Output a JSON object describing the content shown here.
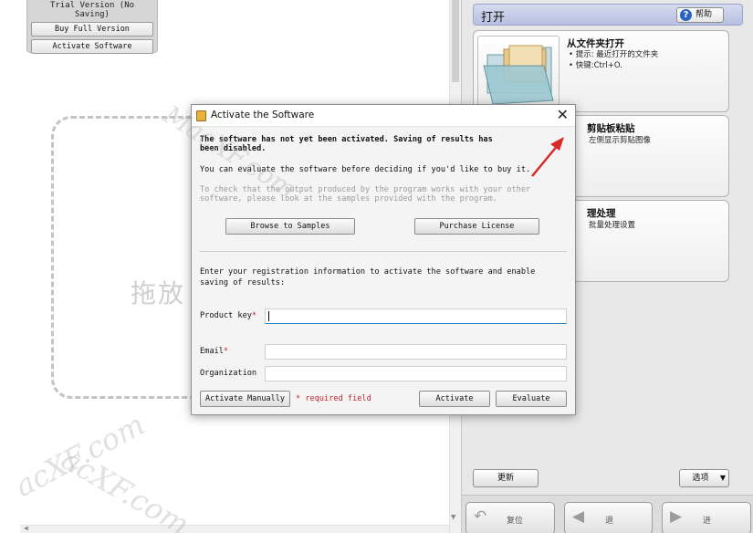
{
  "trial": {
    "status": "Trial Version (No Saving)",
    "buy_label": "Buy Full Version",
    "activate_label": "Activate Software"
  },
  "canvas": {
    "drop_hint": "拖放"
  },
  "right_panel": {
    "header_title": "打开",
    "help_label": "帮助",
    "cards": [
      {
        "title": "从文件夹打开",
        "lines": [
          "• 提示: 最近打开的文件夹",
          "• 快键:Ctrl+O."
        ]
      },
      {
        "title": "剪贴板粘贴",
        "lines": [
          "左侧显示剪贴图像"
        ]
      },
      {
        "title": "理处理",
        "lines": [
          "批量处理设置"
        ]
      }
    ],
    "update_label": "更新",
    "options_label": "选项",
    "nav": {
      "reset_label": "复位",
      "back_label": "退",
      "forward_label": "进"
    }
  },
  "dialog": {
    "title": "Activate the Software",
    "warning_line1": "The software has not yet been activated. Saving of results has",
    "warning_line2": "been disabled.",
    "evaluate_note": "You can evaluate the software before deciding if you'd like to buy it.",
    "samples_note_line1": "To check that the output produced by the program works with your other",
    "samples_note_line2": "software, please look at the samples provided with the program.",
    "browse_label": "Browse to Samples",
    "purchase_label": "Purchase License",
    "register_line1": "Enter your registration information to activate the software and enable",
    "register_line2": "saving of results:",
    "product_key_label": "Product key",
    "email_label": "Email",
    "organization_label": "Organization",
    "required_mark": "*",
    "required_note": "* required field",
    "activate_manually_label": "Activate Manually",
    "activate_label": "Activate",
    "evaluate_label": "Evaluate",
    "product_key_value": "",
    "email_value": "",
    "organization_value": ""
  },
  "watermarks": [
    "MacXF.com",
    "acXF.com",
    "acXF.com"
  ],
  "colors": {
    "header_blue": "#b7c0e2",
    "help_icon": "#2b61c4",
    "required_red": "#c0272d",
    "arrow_red": "#d62a2a"
  }
}
